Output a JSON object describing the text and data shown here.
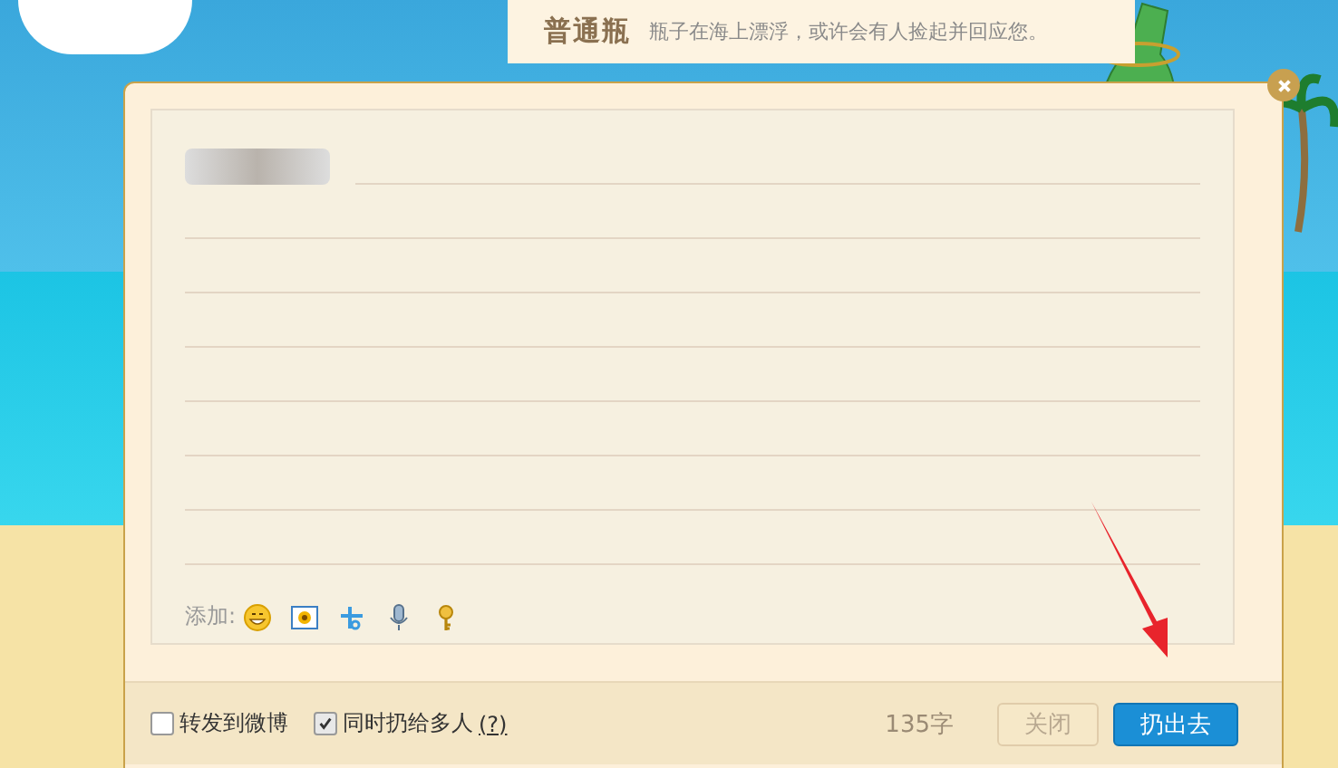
{
  "banner": {
    "title": "普通瓶",
    "subtitle": "瓶子在海上漂浮，或许会有人捡起并回应您。"
  },
  "editor": {
    "add_label": "添加:"
  },
  "footer": {
    "options": [
      {
        "label": "转发到微博",
        "checked": false
      },
      {
        "label": "同时扔给多人",
        "checked": true,
        "help": "(?)"
      }
    ],
    "char_count": "135字",
    "buttons": [
      {
        "label": "关闭",
        "kind": "secondary"
      },
      {
        "label": "扔出去",
        "kind": "primary"
      }
    ]
  }
}
